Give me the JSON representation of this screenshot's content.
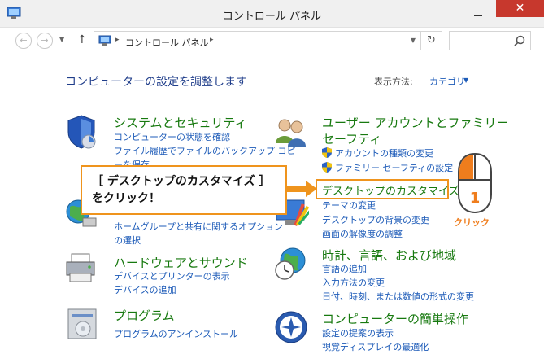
{
  "window": {
    "title": "コントロール パネル",
    "close_symbol": "✕"
  },
  "address": {
    "path": "コントロール パネル",
    "separator": "▸",
    "refresh_symbol": "↻"
  },
  "header": {
    "heading": "コンピューターの設定を調整します",
    "view_by_label": "表示方法:",
    "view_by_value": "カテゴリ"
  },
  "categories": {
    "system": {
      "title": "システムとセキュリティ",
      "links": [
        "コンピューターの状態を確認",
        "ファイル履歴でファイルのバックアップ コピ",
        "ーを保存"
      ]
    },
    "network": {
      "links": [
        "ホームグループと共有に関するオプション",
        "の選択"
      ]
    },
    "hardware": {
      "title": "ハードウェアとサウンド",
      "links": [
        "デバイスとプリンターの表示",
        "デバイスの追加"
      ]
    },
    "programs": {
      "title": "プログラム",
      "links": [
        "プログラムのアンインストール"
      ]
    },
    "accounts": {
      "title": "ユーザー アカウントとファミリー",
      "title2": "セーフティ",
      "links": [
        "アカウントの種類の変更",
        "ファミリー セーフティの設定"
      ]
    },
    "appearance": {
      "title": "デスクトップのカスタマイズ",
      "links": [
        "テーマの変更",
        "デスクトップの背景の変更",
        "画面の解像度の調整"
      ]
    },
    "clock": {
      "title": "時計、言語、および地域",
      "links": [
        "言語の追加",
        "入力方法の変更",
        "日付、時刻、または数値の形式の変更"
      ]
    },
    "ease": {
      "title": "コンピューターの簡単操作",
      "links": [
        "設定の提案の表示",
        "視覚ディスプレイの最適化"
      ]
    }
  },
  "overlay": {
    "callout": "［ デスクトップのカスタマイズ ］\nをクリック！",
    "mouse_number": "1",
    "click_label": "クリック"
  }
}
